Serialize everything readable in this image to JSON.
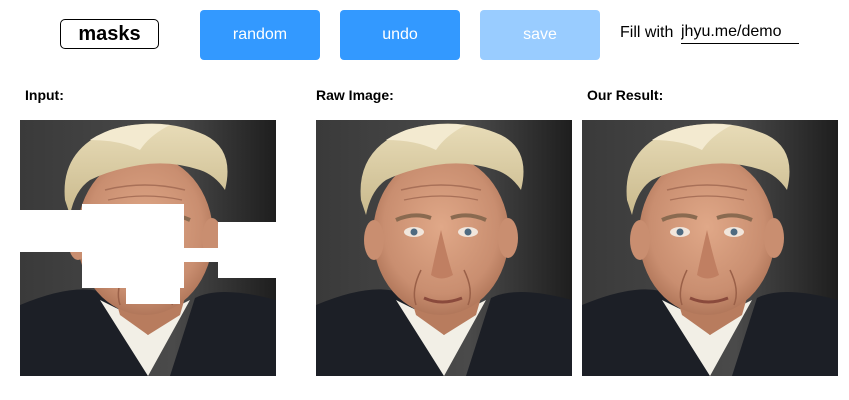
{
  "toolbar": {
    "masks_label": "masks",
    "random_label": "random",
    "undo_label": "undo",
    "save_label": "save",
    "fill_label": "Fill with",
    "fill_value": "jhyu.me/demo"
  },
  "panels": {
    "input_label": "Input:",
    "raw_label": "Raw Image:",
    "result_label": "Our Result:"
  },
  "colors": {
    "button_active": "#3399ff",
    "button_disabled": "#99ccff",
    "background": "#ffffff"
  }
}
